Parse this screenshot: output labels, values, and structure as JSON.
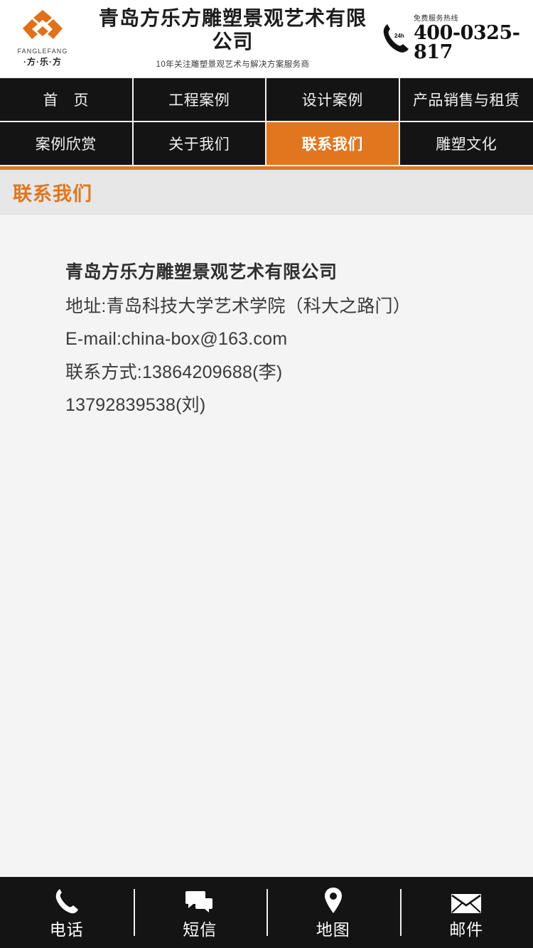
{
  "header": {
    "logo": {
      "icon": "diamond-blocks-logo",
      "en_text": "FANGLEFANG",
      "cn_text": "·方·乐·方"
    },
    "company_name": "青岛方乐方雕塑景观艺术有限公司",
    "slogan": "10年关注雕塑景观艺术与解决方案服务商",
    "hotline": {
      "icon": "phone-handset-icon",
      "badge": "24h",
      "label": "免费服务热线",
      "number": "400-0325-817"
    }
  },
  "nav": {
    "items": [
      {
        "label": "首　页",
        "active": false
      },
      {
        "label": "工程案例",
        "active": false
      },
      {
        "label": "设计案例",
        "active": false
      },
      {
        "label": "产品销售与租赁",
        "active": false
      },
      {
        "label": "案例欣赏",
        "active": false
      },
      {
        "label": "关于我们",
        "active": false
      },
      {
        "label": "联系我们",
        "active": true
      },
      {
        "label": "雕塑文化",
        "active": false
      }
    ]
  },
  "page": {
    "title": "联系我们"
  },
  "contact": {
    "company": "青岛方乐方雕塑景观艺术有限公司",
    "lines": [
      "地址:青岛科技大学艺术学院（科大之路门）",
      "E-mail:china-box@163.com",
      "联系方式:13864209688(李)",
      "13792839538(刘)"
    ]
  },
  "bottom_bar": {
    "items": [
      {
        "label": "电话",
        "icon": "phone-icon"
      },
      {
        "label": "短信",
        "icon": "chat-bubbles-icon"
      },
      {
        "label": "地图",
        "icon": "map-pin-icon"
      },
      {
        "label": "邮件",
        "icon": "envelope-icon"
      }
    ]
  },
  "colors": {
    "accent": "#e1761f",
    "nav_bg": "#141414",
    "page_bg": "#f4f4f4",
    "title_band": "#e7e7e7"
  }
}
